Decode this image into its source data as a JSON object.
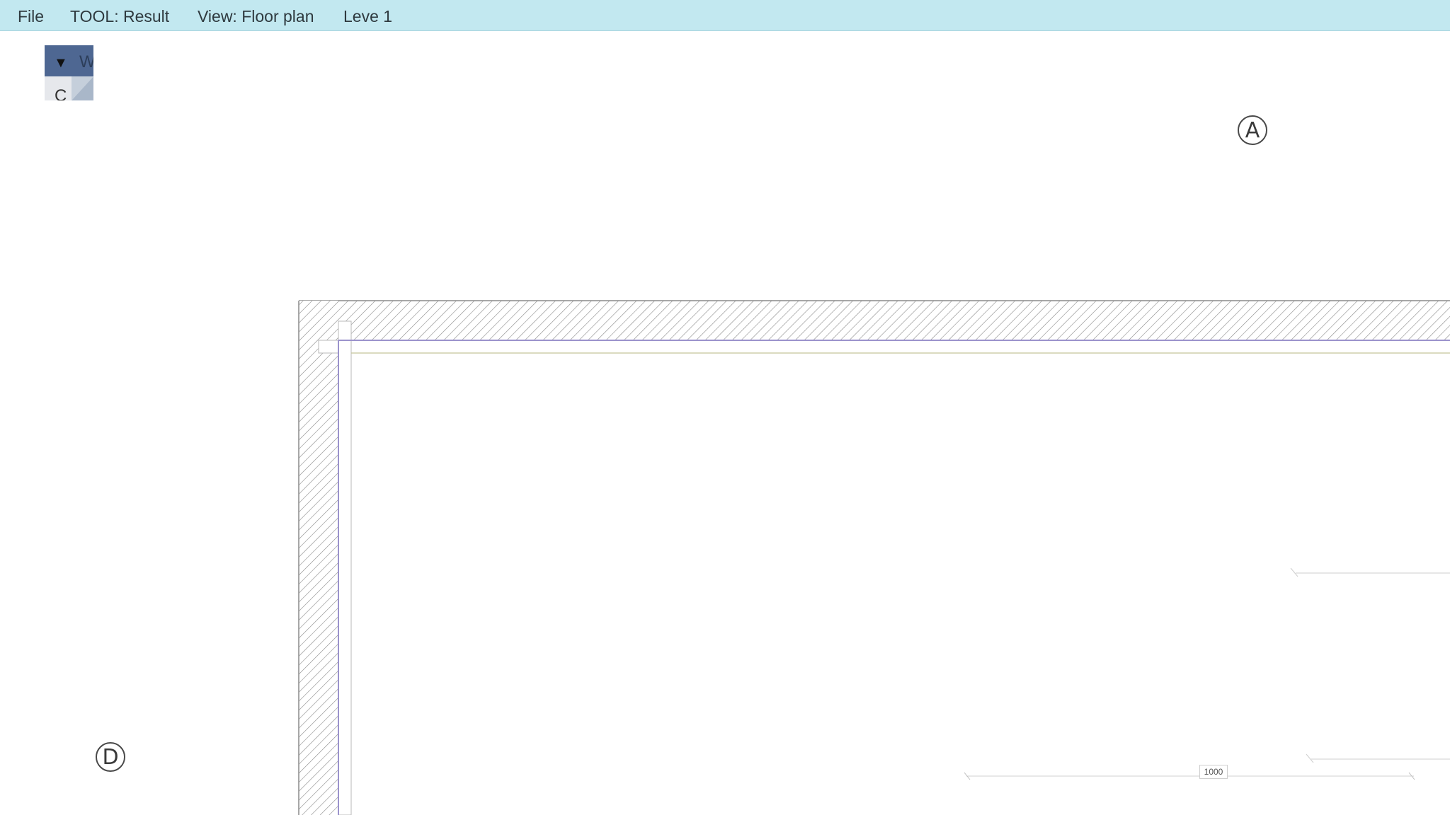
{
  "menubar": {
    "file_label": "File",
    "tool_label": "TOOL: Result",
    "view_label": "View: Floor plan",
    "level_label": "Leve 1",
    "background_color": "#c2e8f0"
  },
  "widget": {
    "toggle_icon": "triangle-down-icon",
    "header_text": "W",
    "body_text": "C",
    "header_color": "#4e6792"
  },
  "grid_markers": {
    "a_label": "A",
    "d_label": "D"
  },
  "plan": {
    "dimension_value": "1000",
    "wall_outline_color": "#9b93cc"
  }
}
